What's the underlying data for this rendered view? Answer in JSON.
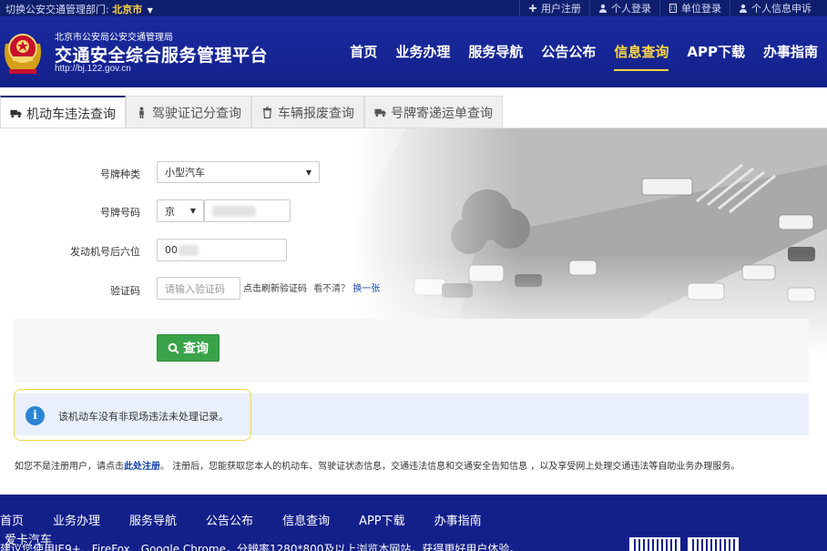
{
  "topbar": {
    "switch_label": "切换公安交通管理部门:",
    "city": "北京市",
    "links": [
      {
        "label": "用户注册",
        "icon": "plus-icon"
      },
      {
        "label": "个人登录",
        "icon": "user-icon"
      },
      {
        "label": "单位登录",
        "icon": "building-icon"
      },
      {
        "label": "个人信息申诉",
        "icon": "user-icon"
      }
    ]
  },
  "header": {
    "org_sub": "北京市公安局公安交通管理局",
    "title": "交通安全综合服务管理平台",
    "url": "http://bj.122.gov.cn",
    "nav": [
      "首页",
      "业务办理",
      "服务导航",
      "公告公布",
      "信息查询",
      "APP下载",
      "办事指南"
    ],
    "active_nav": "信息查询"
  },
  "tabs": [
    {
      "label": "机动车违法查询",
      "icon": "truck-icon",
      "active": true
    },
    {
      "label": "驾驶证记分查询",
      "icon": "person-icon",
      "active": false
    },
    {
      "label": "车辆报废查询",
      "icon": "trash-icon",
      "active": false
    },
    {
      "label": "号牌寄递运单查询",
      "icon": "truck-icon",
      "active": false
    }
  ],
  "form": {
    "plate_type_label": "号牌种类",
    "plate_type_value": "小型汽车",
    "plate_number_label": "号牌号码",
    "plate_prefix_value": "京",
    "engine_label": "发动机号后六位",
    "engine_value": "00",
    "captcha_label": "验证码",
    "captcha_placeholder": "请输入验证码",
    "captcha_hint": "点击刷新验证码",
    "unclear_text": "看不清？",
    "change_link": "换一张",
    "search_button": "查询"
  },
  "alert": {
    "icon": "info-icon",
    "message": "该机动车没有非现场违法未处理记录。"
  },
  "notice": {
    "prefix": "如您不是注册用户，请点击",
    "link": "此处注册",
    "suffix": "。 注册后，您能获取您本人的机动车、驾驶证状态信息，交通违法信息和交通安全告知信息 ，以及享受网上处理交通违法等自助业务办理服务。"
  },
  "footer": {
    "nav": [
      "首页",
      "业务办理",
      "服务导航",
      "公告公布",
      "信息查询",
      "APP下载",
      "办事指南"
    ],
    "brand": "爱卡汽车",
    "tip": "建议您使用IE9+、FireFox、Google Chrome，分辨率1280*800及以上浏览本网站，获得更好用户体验。"
  },
  "colors": {
    "header_bg": "#13218a",
    "active_nav": "#ffd740",
    "search_button": "#3aa349",
    "alert_border": "#f0d84a",
    "info_icon": "#2b86d6"
  }
}
